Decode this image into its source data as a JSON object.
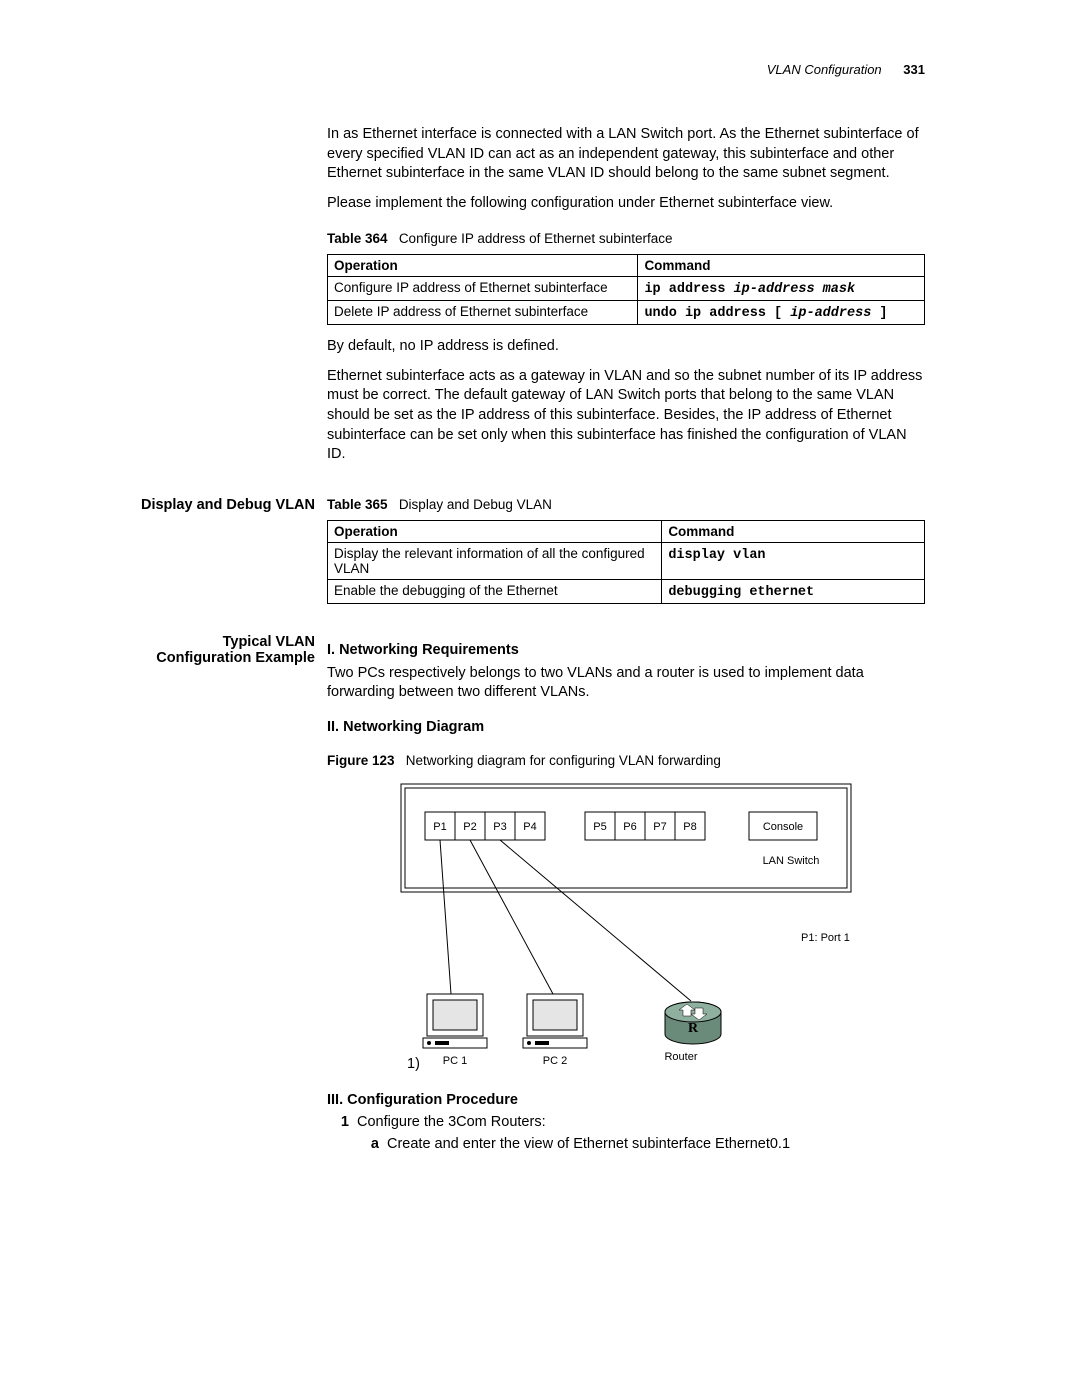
{
  "header": {
    "chapter": "VLAN Configuration",
    "page": "331"
  },
  "intro": {
    "p1": "In as Ethernet interface is connected with a LAN Switch port. As the Ethernet subinterface of every specified VLAN ID can act as an independent gateway, this subinterface and other Ethernet subinterface in the same VLAN ID should belong to the same subnet segment.",
    "p2": "Please implement the following configuration under Ethernet subinterface view."
  },
  "table364": {
    "label": "Table 364",
    "caption": "Configure IP address of Ethernet subinterface",
    "headers": [
      "Operation",
      "Command"
    ],
    "rows": [
      {
        "op": "Configure IP address of Ethernet subinterface",
        "cmd": "ip address",
        "arg": "ip-address mask"
      },
      {
        "op": "Delete IP address of Ethernet subinterface",
        "cmd": "undo ip address [",
        "arg": "ip-address",
        "tail": " ]"
      }
    ]
  },
  "afterT364": {
    "p1": "By default, no IP address is defined.",
    "p2": "Ethernet subinterface acts as a gateway in VLAN and so the subnet number of its IP address must be correct. The default gateway of LAN Switch ports that belong to the same VLAN should be set as the IP address of this subinterface. Besides, the IP address of Ethernet subinterface can be set only when this subinterface has finished the configuration of VLAN ID."
  },
  "displayDebug": {
    "margin": "Display and Debug VLAN",
    "table": {
      "label": "Table 365",
      "caption": "Display and Debug VLAN",
      "headers": [
        "Operation",
        "Command"
      ],
      "rows": [
        {
          "op": "Display the relevant information of all the configured VLAN",
          "cmd": "display vlan"
        },
        {
          "op": "Enable the debugging of the Ethernet",
          "cmd": "debugging ethernet"
        }
      ]
    }
  },
  "example": {
    "margin": "Typical VLAN Configuration Example",
    "h1": "I. Networking Requirements",
    "p1": "Two PCs respectively belongs to two VLANs and a router is used to implement data forwarding between two different VLANs.",
    "h2": "II. Networking Diagram",
    "figLabel": "Figure 123",
    "figCaption": "Networking diagram for configuring VLAN forwarding",
    "diagram": {
      "ports": [
        "P1",
        "P2",
        "P3",
        "P4",
        "P5",
        "P6",
        "P7",
        "P8"
      ],
      "console": "Console",
      "lanswitch": "LAN Switch",
      "pc1": "PC 1",
      "pc2": "PC 2",
      "router": "Router",
      "portNote": "P1: Port 1",
      "enumMarker": "1)"
    },
    "h3": "III. Configuration Procedure",
    "step1num": "1",
    "step1": "Configure the 3Com Routers:",
    "step1a_num": "a",
    "step1a": "Create and enter the view of Ethernet subinterface Ethernet0.1"
  }
}
